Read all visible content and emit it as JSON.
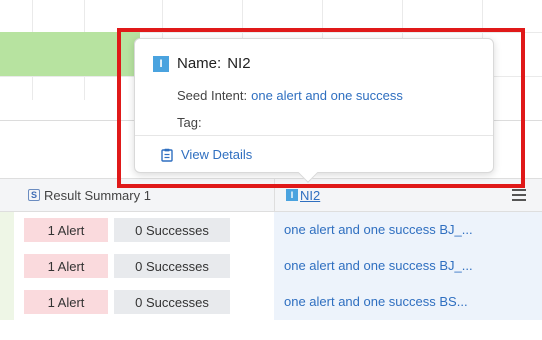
{
  "popover": {
    "title_label": "Name:",
    "title_value": "NI2",
    "signal_icon_letter": "I",
    "seed_intent_label": "Seed Intent:",
    "seed_intent_value": "one alert and one success",
    "tag_label": "Tag:",
    "tag_value": "",
    "view_details_label": "View Details"
  },
  "table": {
    "headers": {
      "result_summary_icon_letter": "S",
      "result_summary": "Result Summary 1",
      "intent_icon_letter": "I",
      "intent": "NI2"
    },
    "rows": [
      {
        "alerts": "1 Alert",
        "successes": "0 Successes",
        "intent": "one alert and one success BJ_..."
      },
      {
        "alerts": "1 Alert",
        "successes": "0 Successes",
        "intent": "one alert and one success BJ_..."
      },
      {
        "alerts": "1 Alert",
        "successes": "0 Successes",
        "intent": "one alert and one success BS..."
      }
    ]
  },
  "colors": {
    "highlight": "#e01919",
    "link": "#2f6fc0",
    "alert_bg": "#fadadd",
    "success_bg": "#e8eaed",
    "green_bar": "#b7e3a0"
  }
}
